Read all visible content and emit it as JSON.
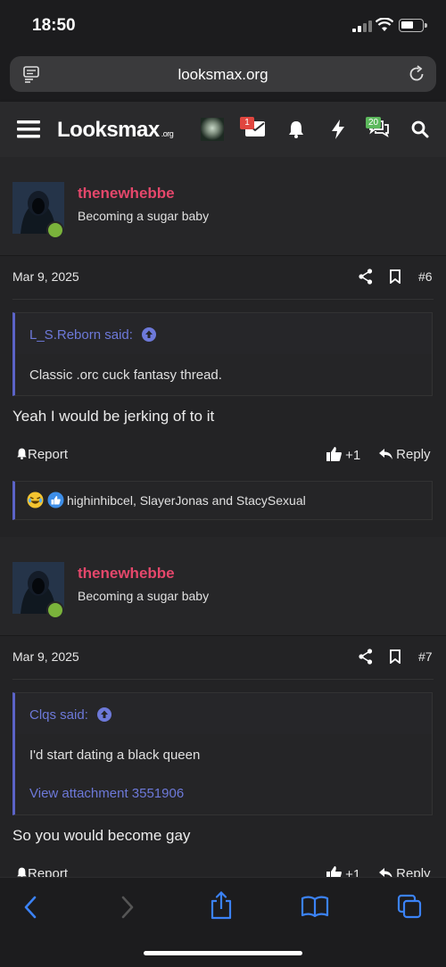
{
  "status_bar": {
    "time": "18:50"
  },
  "browser": {
    "url": "looksmax.org"
  },
  "site": {
    "logo": "Looksmax",
    "logo_suffix": ".org",
    "inbox_count": "1",
    "alerts_count": "20"
  },
  "posts": [
    {
      "username": "thenewhebbe",
      "user_title": "Becoming a sugar baby",
      "date": "Mar 9, 2025",
      "post_number": "#6",
      "quote_author": "L_S.Reborn said:",
      "quote_text": "Classic .orc cuck fantasy thread.",
      "message": "Yeah I would be jerking of to it",
      "report_label": "Report",
      "like_label": "+1",
      "reply_label": "Reply",
      "reactions_text": "highinhibcel, SlayerJonas and StacySexual"
    },
    {
      "username": "thenewhebbe",
      "user_title": "Becoming a sugar baby",
      "date": "Mar 9, 2025",
      "post_number": "#7",
      "quote_author": "Clqs said:",
      "quote_text": "I'd start dating a black queen",
      "quote_attachment": "View attachment 3551906",
      "message": "So you would become gay",
      "report_label": "Report",
      "like_label": "+1",
      "reply_label": "Reply"
    }
  ],
  "colors": {
    "username": "#e5476b",
    "quote_accent": "#5b63c7",
    "link": "#6d79d9",
    "toolbar_icon": "#3b82f6"
  }
}
